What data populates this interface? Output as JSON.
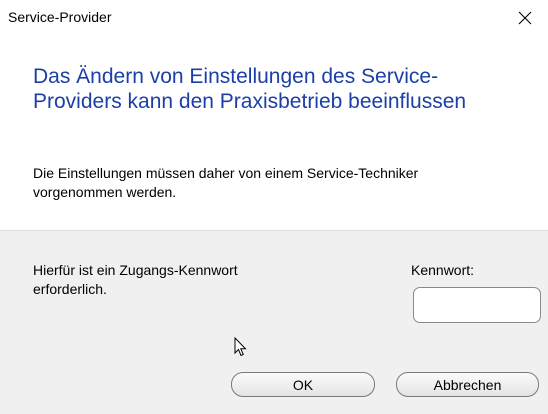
{
  "window": {
    "title": "Service-Provider",
    "close_icon": "close-icon"
  },
  "message": {
    "heading": "Das Ändern von Einstellungen des Service-Providers kann den Praxisbetrieb beeinflussen",
    "subtext": "Die Einstellungen müssen daher von einem Service-Techniker vorgenommen werden."
  },
  "form": {
    "info": "Hierfür ist ein Zugangs-Kennwort erforderlich.",
    "password_label": "Kennwort:",
    "password_value": ""
  },
  "buttons": {
    "ok_label": "OK",
    "cancel_label": "Abbrechen"
  },
  "colors": {
    "heading": "#1b3fa6",
    "footer_bg": "#f0f0f0"
  }
}
